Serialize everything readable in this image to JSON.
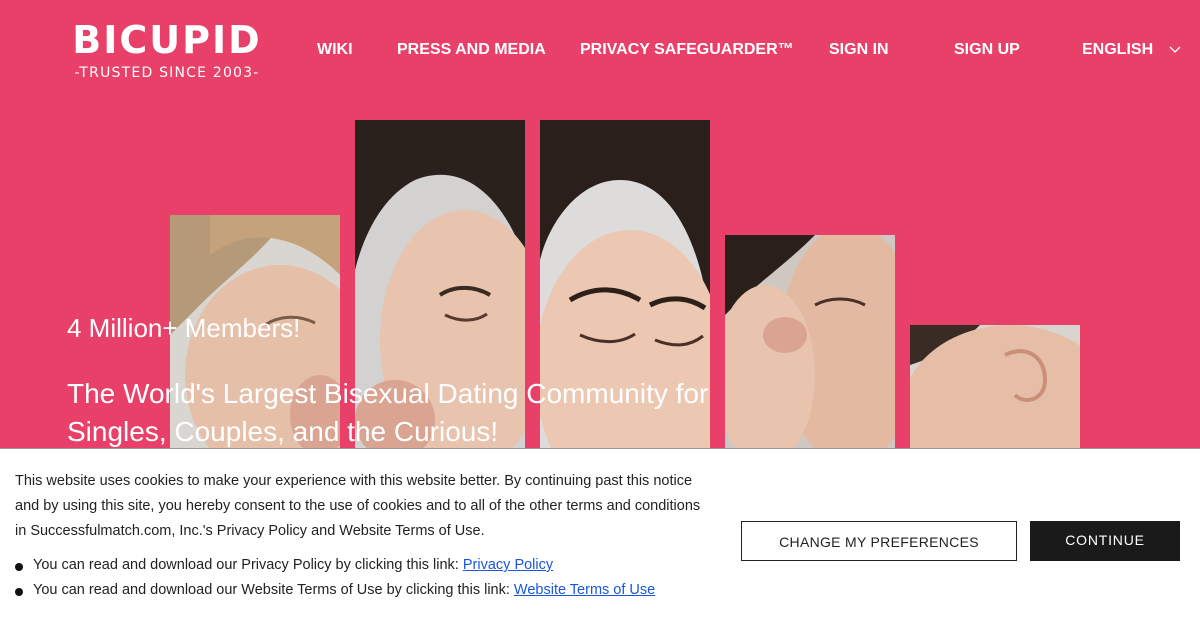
{
  "brand": {
    "name": "BICUPID",
    "tagline": "-TRUSTED SINCE 2003-"
  },
  "nav": {
    "items": [
      {
        "label": "WIKI"
      },
      {
        "label": "PRESS AND MEDIA"
      },
      {
        "label": "PRIVACY SAFEGUARDER™"
      },
      {
        "label": "SIGN IN"
      },
      {
        "label": "SIGN UP"
      }
    ],
    "language": "ENGLISH",
    "language_icon": "chevron-down-icon"
  },
  "hero": {
    "members": "4 Million+ Members!",
    "tagline": "The World's Largest Bisexual Dating Community for Singles, Couples, and the Curious!"
  },
  "cookie_banner": {
    "text": "This website uses cookies to make your experience with this website better. By continuing past this notice and by using this site, you hereby consent to the use of cookies and to all of the other terms and conditions in Successfulmatch.com, Inc.'s Privacy Policy and Website Terms of Use.",
    "links": [
      {
        "prefix": "You can read and download our Privacy Policy by clicking this link:",
        "link_text": "Privacy Policy"
      },
      {
        "prefix": "You can read and download our Website Terms of Use by clicking this link:",
        "link_text": "Website Terms of Use"
      }
    ],
    "preferences_button": "CHANGE MY PREFERENCES",
    "continue_button": "CONTINUE"
  },
  "colors": {
    "brand_pink": "#e84068",
    "link_blue": "#1a56db",
    "button_dark": "#1a1a1a"
  }
}
